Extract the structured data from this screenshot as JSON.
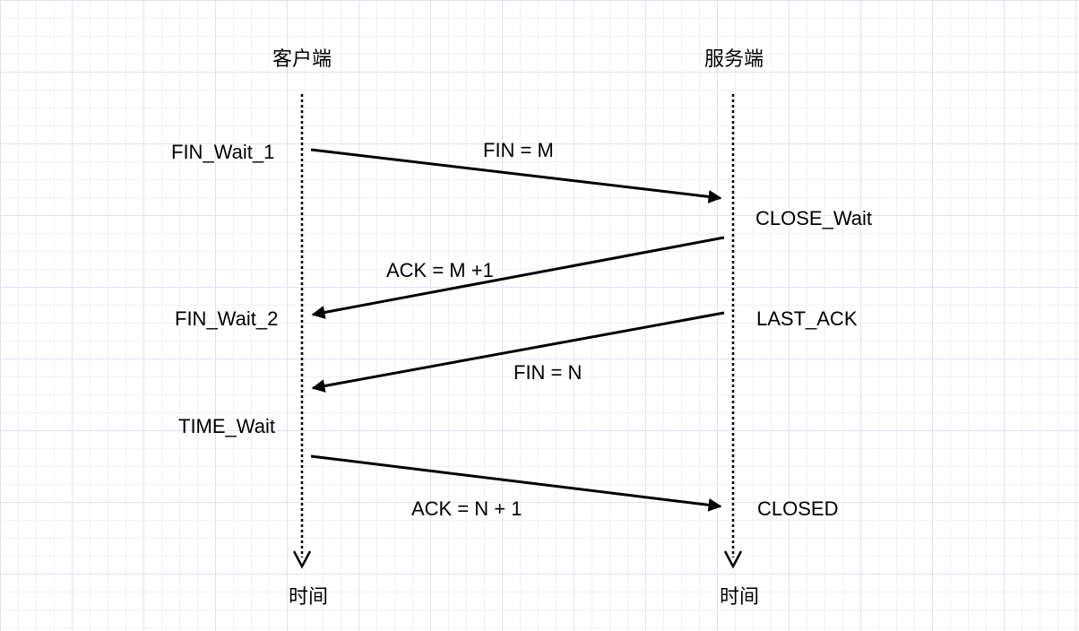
{
  "participants": {
    "client": {
      "title": "客户端",
      "footer": "时间"
    },
    "server": {
      "title": "服务端",
      "footer": "时间"
    }
  },
  "client_states": [
    "FIN_Wait_1",
    "FIN_Wait_2",
    "TIME_Wait"
  ],
  "server_states": [
    "CLOSE_Wait",
    "LAST_ACK",
    "CLOSED"
  ],
  "messages": [
    {
      "label": "FIN = M",
      "from": "client",
      "to": "server"
    },
    {
      "label": "ACK = M +1",
      "from": "server",
      "to": "client"
    },
    {
      "label": "FIN = N",
      "from": "server",
      "to": "client"
    },
    {
      "label": "ACK = N + 1",
      "from": "client",
      "to": "server"
    }
  ]
}
